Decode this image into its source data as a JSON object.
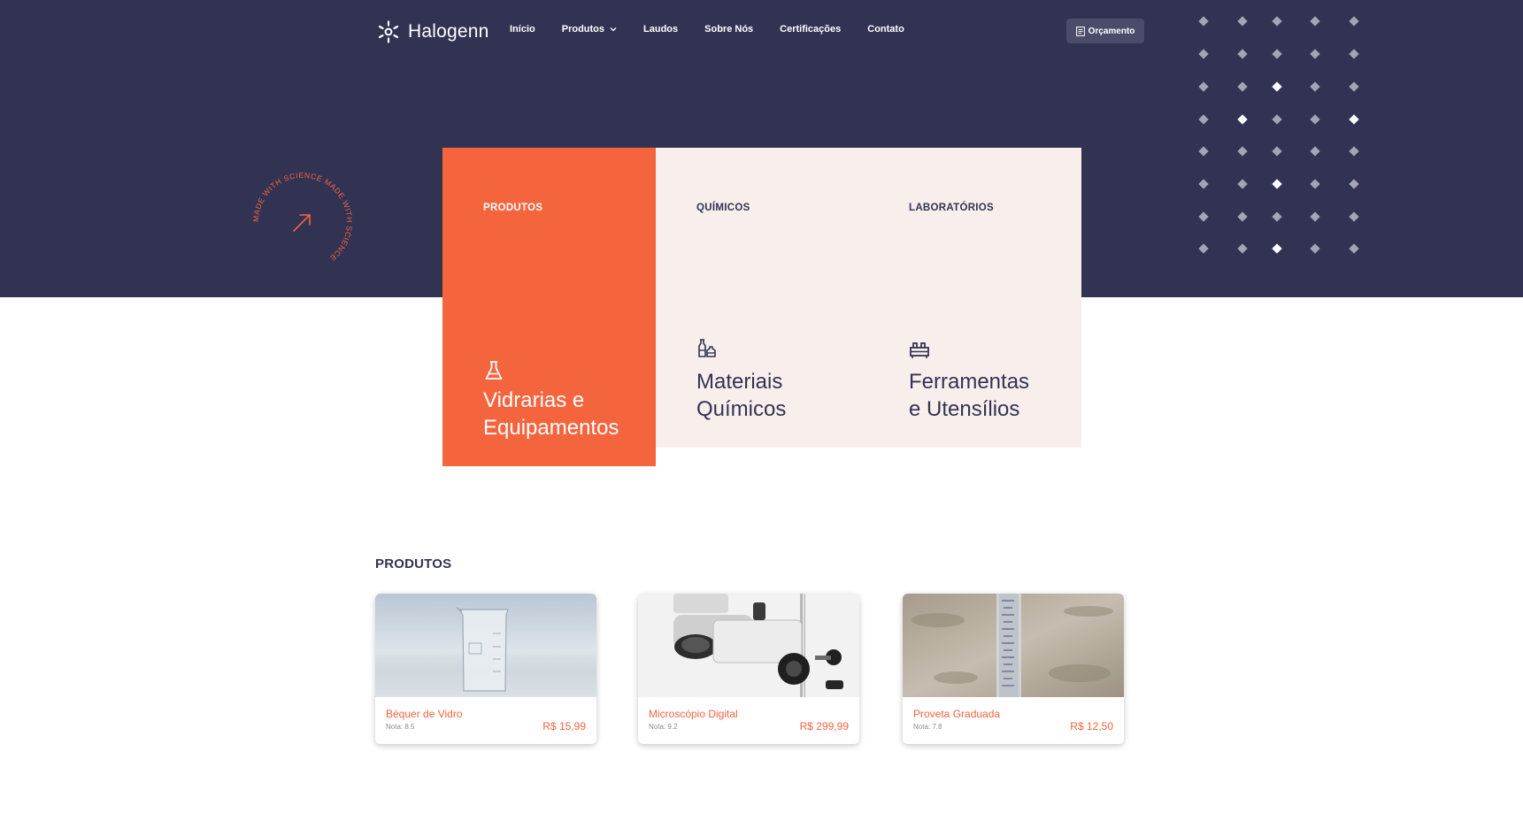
{
  "header": {
    "brand": "Halogenn",
    "nav": [
      {
        "label": "Início"
      },
      {
        "label": "Produtos",
        "has_dropdown": true
      },
      {
        "label": "Laudos"
      },
      {
        "label": "Sobre Nós"
      },
      {
        "label": "Certificações"
      },
      {
        "label": "Contato"
      }
    ],
    "quote_button": "Orçamento"
  },
  "badge": {
    "text": "MADE WITH SCIENCE MADE WITH SCIENCE ",
    "icon": "arrow-up-right-icon"
  },
  "categories": [
    {
      "label": "PRODUTOS",
      "title_line1": "Vidrarias e",
      "title_line2": "Equipamentos",
      "icon": "flask-icon"
    },
    {
      "label": "QUÍMICOS",
      "title_line1": "Materiais",
      "title_line2": "Químicos",
      "icon": "bottles-icon"
    },
    {
      "label": "LABORATÓRIOS",
      "title_line1": "Ferramentas",
      "title_line2": "e Utensílios",
      "icon": "lab-tools-icon"
    }
  ],
  "products": {
    "heading": "PRODUTOS",
    "items": [
      {
        "name": "Béquer de Vidro",
        "rating": "Nota: 8.5",
        "price": "R$ 15,99",
        "image": "beaker-photo"
      },
      {
        "name": "Microscópio Digital",
        "rating": "Nota: 9.2",
        "price": "R$ 299,99",
        "image": "microscope-photo"
      },
      {
        "name": "Proveta Graduada",
        "rating": "Nota: 7.8",
        "price": "R$ 12,50",
        "image": "graduated-cylinder-photo"
      }
    ]
  },
  "colors": {
    "hero_bg": "#323353",
    "accent": "#f4643d",
    "light_card": "#f8efec",
    "dark_text": "#323353"
  }
}
